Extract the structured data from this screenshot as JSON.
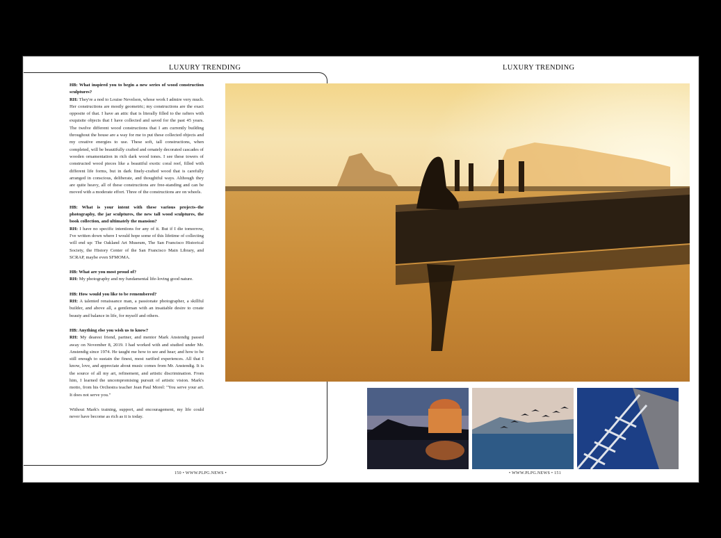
{
  "header": {
    "left": "LUXURY TRENDING",
    "right": "LUXURY TRENDING"
  },
  "article": {
    "qa": [
      {
        "q": "HB: What inspired you to begin a new series of wood construction sculptures?",
        "label": "RH:",
        "a": "They're a nod to Louise Nevelson, whose work I admire very much. Her constructions are mostly geometric; my constructions are the exact opposite of that. I have an attic that is literally filled to the rafters with exquisite objects that I have collected and saved for the past 45 years. The twelve different wood constructions that I am currently building throughout the house are a way for me to put these collected objects and my creative energies to use. These soft, tall constructions, when completed, will be beautifully crafted and ornately decorated cascades of wooden ornamentation in rich dark wood tones. I see these towers of constructed wood pieces like a beautiful exotic coral reef, filled with different life forms, but in dark finely-crafted wood that is carefully arranged in conscious, deliberate, and thoughtful ways. Although they are quite heavy, all of these constructions are free-standing and can be moved with a moderate effort. Three of the constructions are on wheels."
      },
      {
        "q": "HB: What is your intent with these various projects–the photography, the jar sculptures, the new tall wood sculptures, the book collection, and ultimately the mansion?",
        "label": "RH:",
        "a": "I have no specific intentions for any of it. But if I die tomorrow, I've written down where I would hope some of this lifetime of collecting will end up: The Oakland Art Museum, The San Francisco Historical Society, the History Center of the San Francisco Main Library, and SCRAP, maybe even SFMOMA."
      },
      {
        "q": "HB: What are you most proud of?",
        "label": "RH:",
        "a": "My photography and my fundamental life-loving good nature."
      },
      {
        "q": "HB: How would you like to be remembered?",
        "label": "RH:",
        "a": "A talented renaissance man, a passionate photographer, a skillful builder, and above all, a gentleman with an insatiable desire to create beauty and balance in life, for myself and others."
      },
      {
        "q": "HB: Anything else you wish us to know?",
        "label": "RH:",
        "a": "My dearest friend, partner, and mentor Mark Anstendig passed away on November 8, 2019. I had worked with and studied under Mr. Anstendig since 1974. He taught me how to see and hear; and how to be still enough to sustain the finest, most rarified experiences. All that I know, love, and appreciate about music comes from Mr. Anstendig. It is the source of all my art, refinement, and artistic discrimination. From him, I learned the uncompromising pursuit of artistic vision. Mark's motto, from his Orchestra teacher Jean Paul Morel: \"You serve your art. It does not serve you.\""
      }
    ],
    "closing": "Without Mark's training, support, and encouragement, my life could never have become as rich as it is today."
  },
  "folio": {
    "left": "150  •  WWW.PLPG.NEWS  •",
    "right": "•  WWW.PLPG.NEWS  •  151"
  },
  "colors": {
    "sunset": "#e8a63a",
    "sky_glow": "#f7e2a8",
    "water_blue": "#2f5b88",
    "paper": "#ffffff"
  },
  "images": {
    "main": "sunset-pier-silhouettes-photo",
    "thumb1": "palace-of-fine-arts-night-photo",
    "thumb2": "pelicans-over-bay-photo",
    "thumb3": "windmill-sails-photo"
  }
}
